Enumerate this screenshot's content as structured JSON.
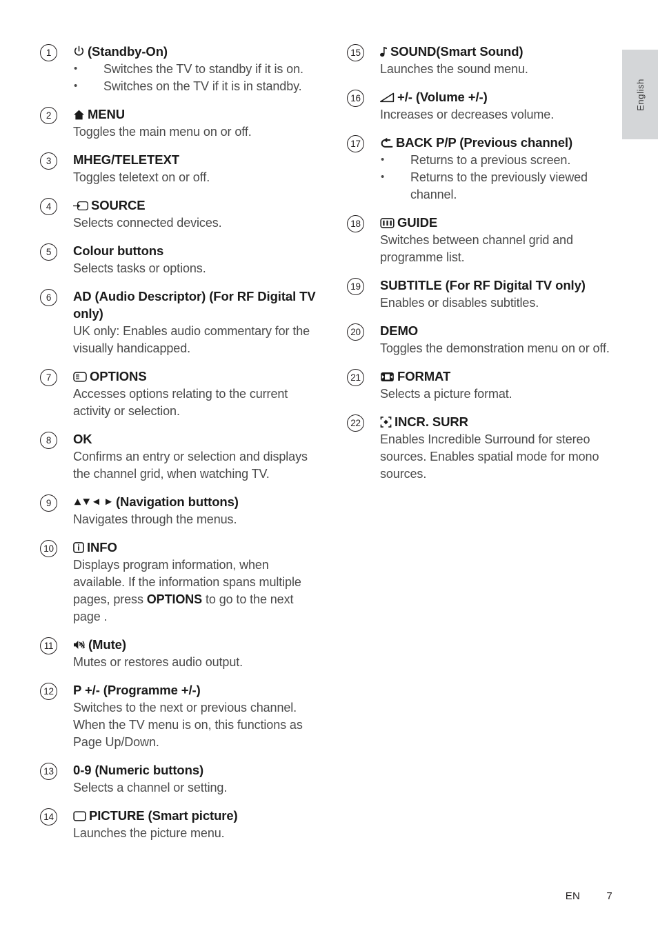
{
  "language_tab": {
    "label": "English"
  },
  "footer": {
    "locale": "EN",
    "page_number": "7"
  },
  "left_column": [
    {
      "number": "1",
      "icon": "power-standby-icon",
      "title": "(Standby-On)",
      "bullets": [
        "Switches the TV to standby if it is on.",
        "Switches on the TV if it is in standby."
      ]
    },
    {
      "number": "2",
      "icon": "home-icon",
      "title": "MENU",
      "desc": "Toggles the main menu on or off."
    },
    {
      "number": "3",
      "icon": null,
      "title": "MHEG/TELETEXT",
      "desc": "Toggles teletext on or off."
    },
    {
      "number": "4",
      "icon": "source-input-icon",
      "title": "SOURCE",
      "desc": "Selects connected devices."
    },
    {
      "number": "5",
      "icon": null,
      "title": "Colour buttons",
      "desc": "Selects tasks or options."
    },
    {
      "number": "6",
      "icon": null,
      "title": "AD (Audio Descriptor) (For RF Digital TV only)",
      "desc": "UK only: Enables audio commentary for the visually handicapped."
    },
    {
      "number": "7",
      "icon": "options-list-icon",
      "title": "OPTIONS",
      "desc": "Accesses options relating to the current activity or selection."
    },
    {
      "number": "8",
      "icon": null,
      "title": "OK",
      "desc": "Confirms an entry or selection and displays the channel grid, when watching TV."
    },
    {
      "number": "9",
      "icon": "navigation-arrows-icon",
      "title": "(Navigation buttons)",
      "desc": "Navigates through the menus."
    },
    {
      "number": "10",
      "icon": "info-icon",
      "title": "INFO",
      "desc_parts": [
        {
          "text": "Displays program information, when available. If the information spans multiple pages, press  ",
          "bold": false
        },
        {
          "text": "OPTIONS",
          "bold": true
        },
        {
          "text": " to go to the next page .",
          "bold": false
        }
      ]
    },
    {
      "number": "11",
      "icon": "mute-icon",
      "title": "(Mute)",
      "desc": "Mutes or restores audio output."
    },
    {
      "number": "12",
      "icon": null,
      "title": "P +/- (Programme +/-)",
      "desc": "Switches to the next or previous channel. When the TV menu is on, this functions as Page Up/Down."
    },
    {
      "number": "13",
      "icon": null,
      "title": "0-9 (Numeric buttons)",
      "desc": "Selects a channel or setting."
    },
    {
      "number": "14",
      "icon": "picture-rect-icon",
      "title": "PICTURE (Smart picture)",
      "desc": "Launches the picture menu."
    }
  ],
  "right_column": [
    {
      "number": "15",
      "icon": "music-note-icon",
      "title": "SOUND(Smart Sound)",
      "desc": "Launches the sound menu."
    },
    {
      "number": "16",
      "icon": "volume-wedge-icon",
      "title": "+/- (Volume +/-)",
      "desc": "Increases or decreases volume."
    },
    {
      "number": "17",
      "icon": "back-arrow-icon",
      "title": "BACK P/P (Previous channel)",
      "bullets": [
        "Returns to a previous screen.",
        "Returns to the previously viewed channel."
      ]
    },
    {
      "number": "18",
      "icon": "guide-grid-icon",
      "title": "GUIDE",
      "desc": "Switches between channel grid and programme list."
    },
    {
      "number": "19",
      "icon": null,
      "title": "SUBTITLE (For RF Digital TV only)",
      "desc": "Enables or disables subtitles."
    },
    {
      "number": "20",
      "icon": null,
      "title": "DEMO",
      "desc": "Toggles the demonstration menu on or off."
    },
    {
      "number": "21",
      "icon": "format-icon",
      "title": "FORMAT",
      "desc": "Selects a picture format."
    },
    {
      "number": "22",
      "icon": "incredible-surround-icon",
      "title": "INCR. SURR",
      "desc": "Enables Incredible Surround for stereo sources. Enables spatial mode for mono sources."
    }
  ]
}
